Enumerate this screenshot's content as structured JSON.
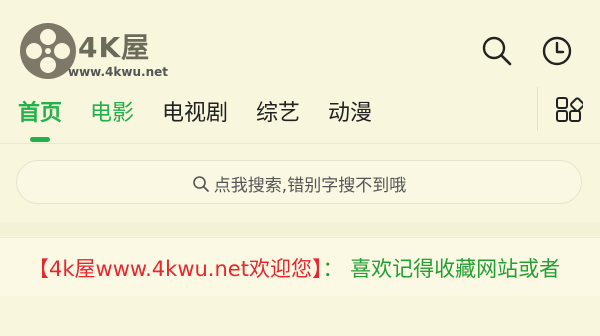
{
  "header": {
    "brand": "4K屋",
    "url": "www.4kwu.net",
    "logo_icon": "film-reel-icon",
    "search_icon": "search-icon",
    "history_icon": "clock-icon"
  },
  "nav": {
    "tabs": [
      {
        "label": "首页",
        "state": "active"
      },
      {
        "label": "电影",
        "state": "highlight"
      },
      {
        "label": "电视剧",
        "state": "normal"
      },
      {
        "label": "综艺",
        "state": "normal"
      },
      {
        "label": "动漫",
        "state": "normal"
      }
    ],
    "more_icon": "grid-icon"
  },
  "search": {
    "placeholder": "点我搜索,错别字搜不到哦",
    "icon": "search-icon"
  },
  "notice": {
    "red_text": "【4k屋www.4kwu.net欢迎您】",
    "green_text": "： 喜欢记得收藏网站或者"
  },
  "colors": {
    "accent": "#22b14c",
    "background": "#f8f6dd",
    "notice_red": "#e8262e"
  }
}
